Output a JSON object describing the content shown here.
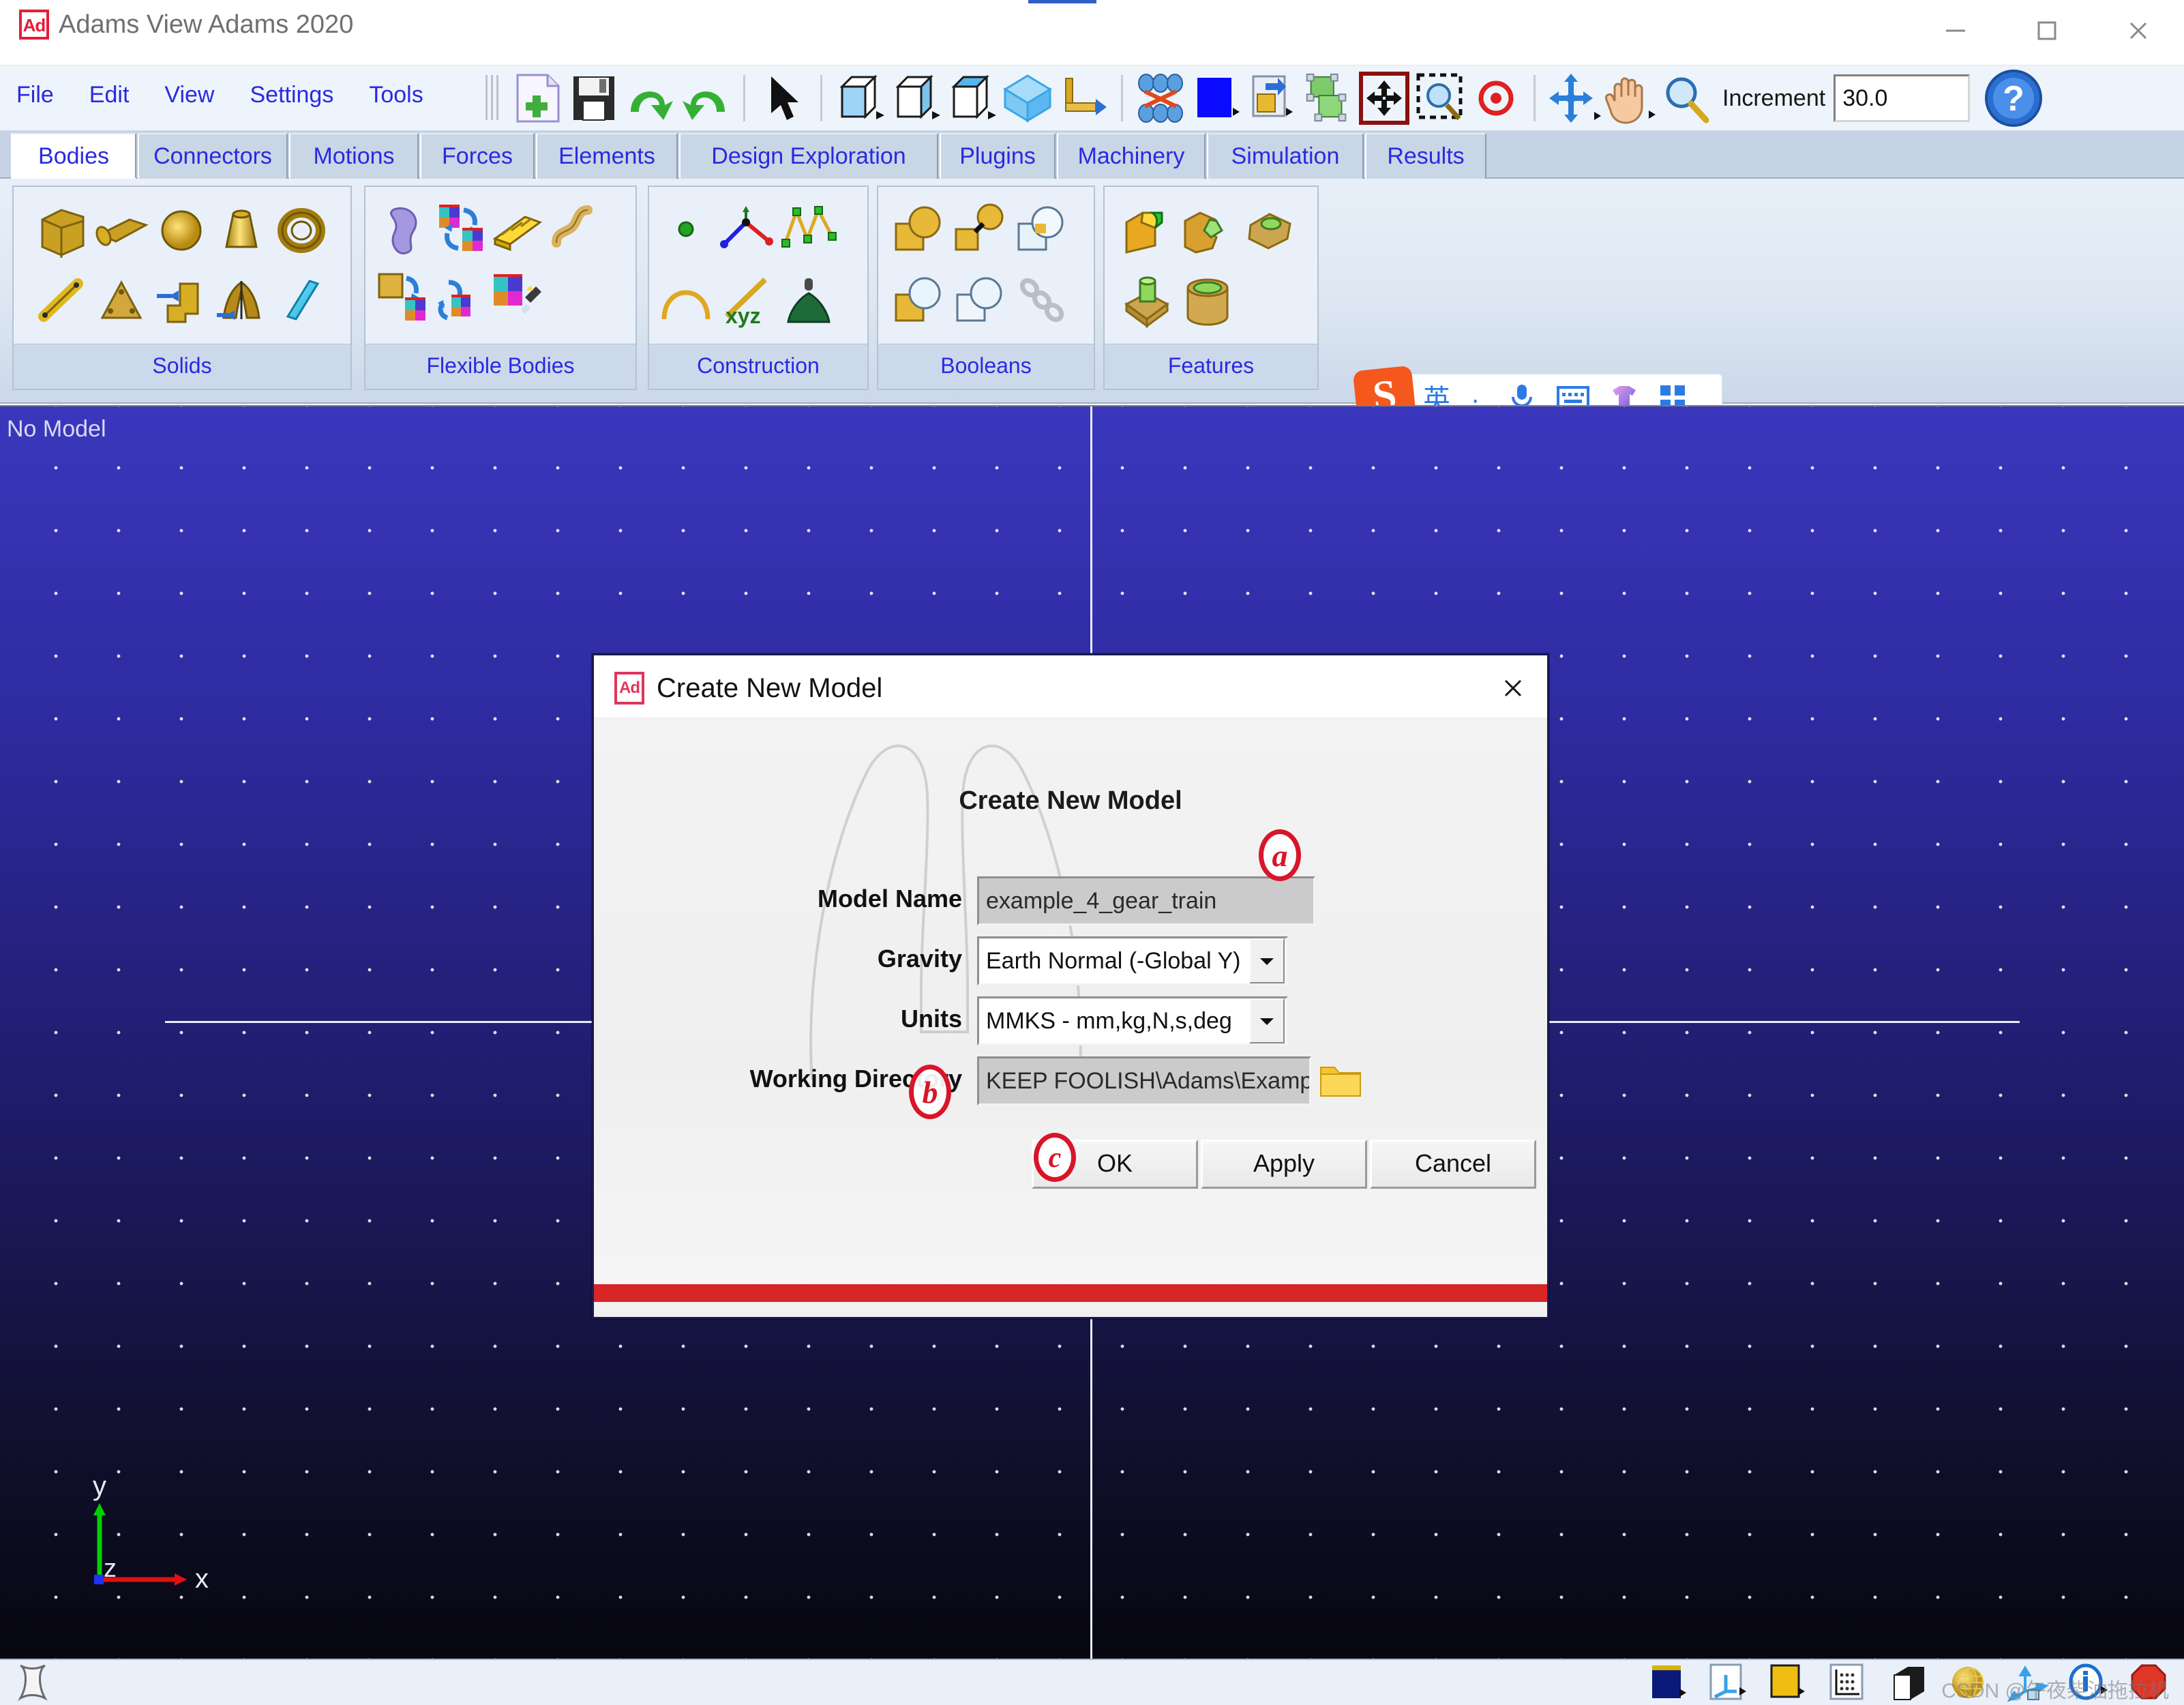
{
  "window": {
    "app_icon": "Ad",
    "title": "Adams View Adams 2020",
    "minimize_icon": "minimize-icon",
    "maximize_icon": "maximize-icon",
    "close_icon": "close-icon"
  },
  "menubar": {
    "items": [
      {
        "label": "File"
      },
      {
        "label": "Edit"
      },
      {
        "label": "View"
      },
      {
        "label": "Settings"
      },
      {
        "label": "Tools"
      }
    ]
  },
  "toolbar": {
    "buttons": [
      {
        "name": "new-model-icon",
        "title": "New Model"
      },
      {
        "name": "save-icon",
        "title": "Save Database"
      },
      {
        "name": "redo-icon",
        "title": "Redo"
      },
      {
        "name": "undo-icon",
        "title": "Undo"
      },
      {
        "name": "select-arrow-icon",
        "title": "Select"
      },
      {
        "name": "front-view-icon",
        "title": "Front View"
      },
      {
        "name": "side-view-icon",
        "title": "Side View"
      },
      {
        "name": "top-view-icon",
        "title": "Top View"
      },
      {
        "name": "iso-view-icon",
        "title": "Isometric View"
      },
      {
        "name": "rotate-view-icon",
        "title": "Rotate View"
      },
      {
        "name": "render-mode-icon",
        "title": "Render Mode"
      },
      {
        "name": "background-color-icon",
        "title": "Background Color"
      },
      {
        "name": "depth-icon",
        "title": "Depth"
      },
      {
        "name": "fit-selection-icon",
        "title": "Fit Selection"
      },
      {
        "name": "translate-icon",
        "title": "Translate"
      },
      {
        "name": "zoom-box-icon",
        "title": "Zoom Box"
      },
      {
        "name": "center-view-icon",
        "title": "Center View"
      },
      {
        "name": "rotate-xyz-icon",
        "title": "Rotate XYZ"
      },
      {
        "name": "pan-hand-icon",
        "title": "Pan"
      },
      {
        "name": "zoom-icon",
        "title": "Zoom"
      }
    ],
    "increment_label": "Increment",
    "increment_value": "30.0",
    "help_icon": "help-icon"
  },
  "ribbon": {
    "tabs": [
      {
        "label": "Bodies",
        "active": true
      },
      {
        "label": "Connectors",
        "active": false
      },
      {
        "label": "Motions",
        "active": false
      },
      {
        "label": "Forces",
        "active": false
      },
      {
        "label": "Elements",
        "active": false
      },
      {
        "label": "Design Exploration",
        "active": false
      },
      {
        "label": "Plugins",
        "active": false
      },
      {
        "label": "Machinery",
        "active": false
      },
      {
        "label": "Simulation",
        "active": false
      },
      {
        "label": "Results",
        "active": false
      }
    ],
    "groups": [
      {
        "label": "Solids",
        "items": [
          "box-icon",
          "cylinder-icon",
          "sphere-icon",
          "frustum-icon",
          "torus-icon",
          "link-icon",
          "plate-icon",
          "extrusion-icon",
          "revolution-icon",
          "plane-icon"
        ]
      },
      {
        "label": "Flexible Bodies",
        "items": [
          "flex-body-icon",
          "rigid-to-flex-icon",
          "beam-icon",
          "flex-spline-icon",
          "rigid-body-convert-icon",
          "flex-swap-icon",
          "flex-edit-icon"
        ]
      },
      {
        "label": "Construction",
        "items": [
          "point-icon",
          "polyline-icon",
          "spline-icon",
          "arc-icon",
          "xyz-marker-icon",
          "csg-icon"
        ]
      },
      {
        "label": "Booleans",
        "items": [
          "unite-icon",
          "merge-icon",
          "cut-icon",
          "intersect-icon",
          "subtract-icon",
          "chain-icon"
        ]
      },
      {
        "label": "Features",
        "items": [
          "chamfer-icon",
          "fillet-icon",
          "hollow-icon",
          "boss-icon",
          "hole-icon"
        ]
      }
    ]
  },
  "ime": {
    "logo": "S",
    "items": [
      {
        "name": "ime-language-toggle",
        "glyph": "英"
      },
      {
        "name": "ime-punctuation-toggle",
        "glyph": "·,"
      },
      {
        "name": "ime-voice-input-icon",
        "glyph": "mic"
      },
      {
        "name": "ime-soft-keyboard-icon",
        "glyph": "keyboard"
      },
      {
        "name": "ime-skin-icon",
        "glyph": "shirt"
      },
      {
        "name": "ime-toolbox-icon",
        "glyph": "grid"
      }
    ]
  },
  "viewport": {
    "status_text": "No Model",
    "triad": {
      "x_label": "x",
      "y_label": "y",
      "z_label": "z",
      "x_color": "#e01010",
      "y_color": "#00d000",
      "z_color": "#2030ff"
    },
    "background_top_color": "#3b37bd",
    "background_bottom_color": "#07070f"
  },
  "statusbar": {
    "left_icon": "model-browser-icon",
    "buttons": [
      "view-background-icon",
      "triad-toggle-icon",
      "icon-visibility-icon",
      "grid-toggle-icon",
      "render-shaded-icon",
      "render-wireframe-icon",
      "coordinate-axes-icon",
      "information-icon",
      "stop-icon"
    ],
    "watermark": "CSDN @午夜柴油拖拉机"
  },
  "dialog": {
    "icon": "Ad",
    "titlebar_title": "Create New Model",
    "close_icon": "close-icon",
    "heading": "Create New Model",
    "fields": [
      {
        "label": "Model Name",
        "value": "example_4_gear_train",
        "type": "text",
        "name": "model-name-field"
      },
      {
        "label": "Gravity",
        "value": "Earth Normal (-Global Y)",
        "type": "combo",
        "name": "gravity-select"
      },
      {
        "label": "Units",
        "value": "MMKS - mm,kg,N,s,deg",
        "type": "combo",
        "name": "units-select"
      },
      {
        "label": "Working Directory",
        "value": "KEEP FOOLISH\\Adams\\Example\\Temp",
        "type": "text",
        "name": "working-directory-field"
      }
    ],
    "browse_icon": "folder-icon",
    "buttons": [
      {
        "label": "OK",
        "name": "ok-button"
      },
      {
        "label": "Apply",
        "name": "apply-button"
      },
      {
        "label": "Cancel",
        "name": "cancel-button"
      }
    ]
  },
  "annotations": [
    {
      "label": "a",
      "target": "model-name-field"
    },
    {
      "label": "b",
      "target": "working-directory-field"
    },
    {
      "label": "c",
      "target": "ok-button"
    }
  ],
  "colors": {
    "menu_text": "#2a2ae0",
    "annotation_red": "#d8152a",
    "dialog_red_bar": "#d82626",
    "ribbon_tab_active_bg": "#ffffff",
    "viewport_blue": "#3b37bd"
  }
}
